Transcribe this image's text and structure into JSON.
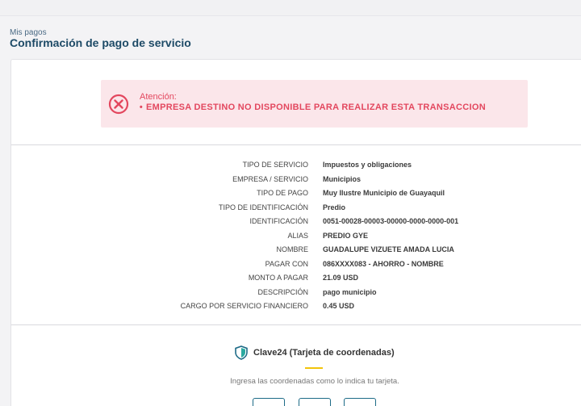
{
  "header": {
    "breadcrumb": "Mis pagos",
    "title": "Confirmación de pago de servicio"
  },
  "alert": {
    "icon": "error-circle-x-icon",
    "color": "#e3475e",
    "background": "#fbe6ea",
    "title": "Atención:",
    "message": "EMPRESA DESTINO NO DISPONIBLE PARA REALIZAR ESTA TRANSACCION"
  },
  "details": [
    {
      "label": "TIPO DE SERVICIO",
      "value": "Impuestos y obligaciones"
    },
    {
      "label": "EMPRESA / SERVICIO",
      "value": "Municipios"
    },
    {
      "label": "TIPO DE PAGO",
      "value": "Muy Ilustre Municipio de Guayaquil"
    },
    {
      "label": "TIPO DE IDENTIFICACIÓN",
      "value": "Predio"
    },
    {
      "label": "IDENTIFICACIÓN",
      "value": "0051-00028-00003-00000-0000-0000-001"
    },
    {
      "label": "ALIAS",
      "value": "PREDIO GYE"
    },
    {
      "label": "NOMBRE",
      "value": "GUADALUPE VIZUETE AMADA LUCIA"
    },
    {
      "label": "PAGAR CON",
      "value": "086XXXX083 - AHORRO - NOMBRE"
    },
    {
      "label": "MONTO A PAGAR",
      "value": "21.09 USD"
    },
    {
      "label": "DESCRIPCIÓN",
      "value": "pago municipio"
    },
    {
      "label": "CARGO POR SERVICIO FINANCIERO",
      "value": "0.45 USD"
    }
  ],
  "clave": {
    "icon": "shield-icon",
    "title": "Clave24 (Tarjeta de coordenadas)",
    "hint": "Ingresa las coordenadas como lo indica tu tarjeta.",
    "accent": "#f2c40a"
  }
}
